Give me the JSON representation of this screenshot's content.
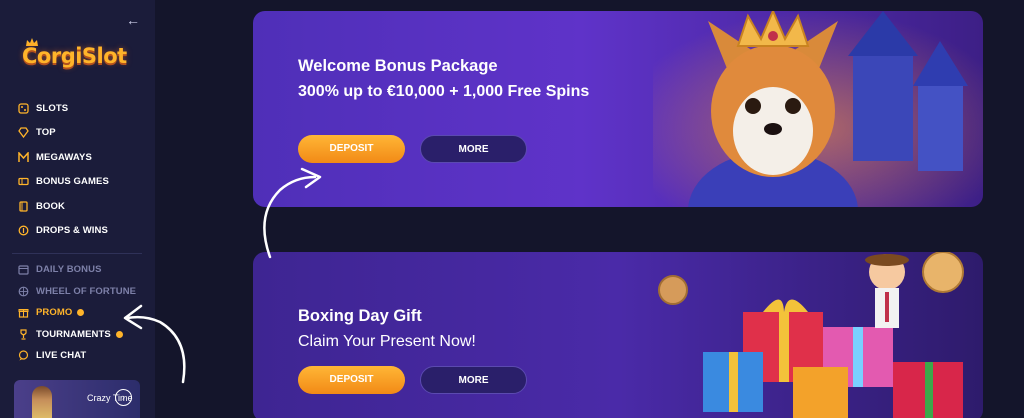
{
  "brand": {
    "name": "CorgiSlot"
  },
  "sidebar": {
    "primary": [
      {
        "label": "SLOTS",
        "icon": "dice-icon"
      },
      {
        "label": "TOP",
        "icon": "diamond-icon"
      },
      {
        "label": "MEGAWAYS",
        "icon": "megaways-icon"
      },
      {
        "label": "BONUS GAMES",
        "icon": "ticket-icon"
      },
      {
        "label": "BOOK",
        "icon": "book-icon"
      },
      {
        "label": "DROPS & WINS",
        "icon": "coins-icon"
      }
    ],
    "secondary": [
      {
        "label": "DAILY BONUS",
        "icon": "calendar-icon"
      },
      {
        "label": "WHEEL OF FORTUNE",
        "icon": "wheel-icon"
      },
      {
        "label": "PROMO",
        "icon": "gift-icon"
      },
      {
        "label": "TOURNAMENTS",
        "icon": "trophy-icon"
      },
      {
        "label": "LIVE CHAT",
        "icon": "chat-icon"
      }
    ],
    "game_card": {
      "label": "Crazy Time"
    }
  },
  "banners": [
    {
      "title": "Welcome Bonus Package",
      "subtitle": "300% up to €10,000 + 1,000 Free Spins",
      "deposit_label": "DEPOSIT",
      "more_label": "MORE"
    },
    {
      "title": "Boxing Day Gift",
      "subtitle": "Claim Your Present Now!",
      "deposit_label": "DEPOSIT",
      "more_label": "MORE"
    }
  ],
  "colors": {
    "accent": "#ffb42a",
    "sidebar_bg": "#1b1c3a",
    "page_bg": "#14152b",
    "banner_purple": "#5a32c4"
  }
}
